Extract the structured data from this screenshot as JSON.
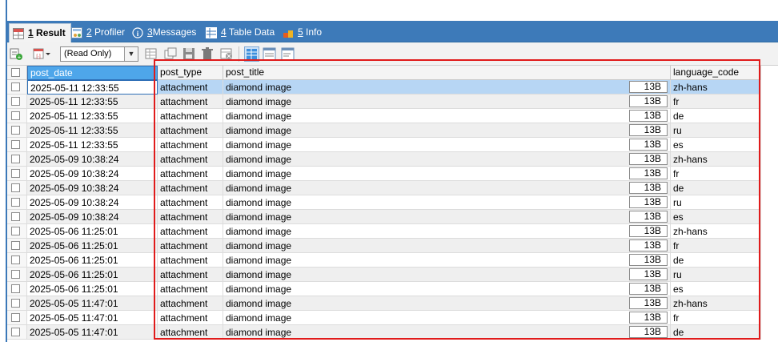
{
  "tabs": [
    {
      "num": "1",
      "label": "Result",
      "icon": "result-grid-icon",
      "active": true
    },
    {
      "num": "2",
      "label": "Profiler",
      "icon": "profiler-icon"
    },
    {
      "num": "3",
      "label": "Messages",
      "icon": "info-circle-icon"
    },
    {
      "num": "4",
      "label": "Table Data",
      "icon": "table-icon"
    },
    {
      "num": "5",
      "label": "Info",
      "icon": "info-blocks-icon"
    }
  ],
  "toolbar": {
    "mode_select": "(Read Only)",
    "icons": [
      "export-icon",
      "row-filter-icon",
      "refresh-icon",
      "copy-icon",
      "save-icon",
      "delete-icon",
      "cancel-icon",
      "grid-view-icon",
      "form-view-icon",
      "text-view-icon"
    ]
  },
  "columns": [
    "post_date",
    "post_type",
    "post_title",
    "language_code"
  ],
  "rows": [
    [
      "2025-05-11 12:33:55",
      "attachment",
      "diamond image",
      "13B",
      "zh-hans"
    ],
    [
      "2025-05-11 12:33:55",
      "attachment",
      "diamond image",
      "13B",
      "fr"
    ],
    [
      "2025-05-11 12:33:55",
      "attachment",
      "diamond image",
      "13B",
      "de"
    ],
    [
      "2025-05-11 12:33:55",
      "attachment",
      "diamond image",
      "13B",
      "ru"
    ],
    [
      "2025-05-11 12:33:55",
      "attachment",
      "diamond image",
      "13B",
      "es"
    ],
    [
      "2025-05-09 10:38:24",
      "attachment",
      "diamond image",
      "13B",
      "zh-hans"
    ],
    [
      "2025-05-09 10:38:24",
      "attachment",
      "diamond image",
      "13B",
      "fr"
    ],
    [
      "2025-05-09 10:38:24",
      "attachment",
      "diamond image",
      "13B",
      "de"
    ],
    [
      "2025-05-09 10:38:24",
      "attachment",
      "diamond image",
      "13B",
      "ru"
    ],
    [
      "2025-05-09 10:38:24",
      "attachment",
      "diamond image",
      "13B",
      "es"
    ],
    [
      "2025-05-06 11:25:01",
      "attachment",
      "diamond image",
      "13B",
      "zh-hans"
    ],
    [
      "2025-05-06 11:25:01",
      "attachment",
      "diamond image",
      "13B",
      "fr"
    ],
    [
      "2025-05-06 11:25:01",
      "attachment",
      "diamond image",
      "13B",
      "de"
    ],
    [
      "2025-05-06 11:25:01",
      "attachment",
      "diamond image",
      "13B",
      "ru"
    ],
    [
      "2025-05-06 11:25:01",
      "attachment",
      "diamond image",
      "13B",
      "es"
    ],
    [
      "2025-05-05 11:47:01",
      "attachment",
      "diamond image",
      "13B",
      "zh-hans"
    ],
    [
      "2025-05-05 11:47:01",
      "attachment",
      "diamond image",
      "13B",
      "fr"
    ],
    [
      "2025-05-05 11:47:01",
      "attachment",
      "diamond image",
      "13B",
      "de"
    ]
  ],
  "colors": {
    "tabbar": "#3d7ab9",
    "selected_header": "#4ea6ea",
    "selected_row": "#b7d6f4",
    "alt_row": "#efefef",
    "highlight_box": "#e01b1b"
  }
}
